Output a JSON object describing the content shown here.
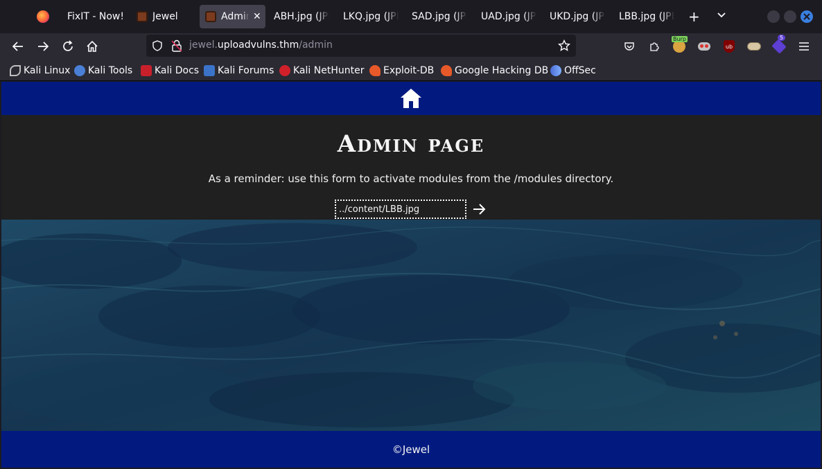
{
  "browser": {
    "tabs": [
      {
        "title": "FixIT - Now!",
        "favicon_color": "#1c1b22"
      },
      {
        "title": "Jewel",
        "favicon_color": "#7a3b1e"
      },
      {
        "title": "Admin",
        "favicon_color": "#7a3b1e",
        "active": true
      },
      {
        "title": "ABH.jpg (JPEG",
        "favicon_color": ""
      },
      {
        "title": "LKQ.jpg (JPEG",
        "favicon_color": ""
      },
      {
        "title": "SAD.jpg (JPEG",
        "favicon_color": ""
      },
      {
        "title": "UAD.jpg (JPEG",
        "favicon_color": ""
      },
      {
        "title": "UKD.jpg (JPEG",
        "favicon_color": ""
      },
      {
        "title": "LBB.jpg (JPEG",
        "favicon_color": ""
      }
    ],
    "url": {
      "prefix": "jewel.",
      "domain": "uploadvulns.thm",
      "path": "/admin"
    },
    "extension_badge": "5",
    "burp_label": "Burp"
  },
  "bookmarks": [
    {
      "label": "Kali Linux",
      "icon": "kali-dragon-icon",
      "color": "#bfbfbf"
    },
    {
      "label": "Kali Tools",
      "icon": "kali-tools-icon",
      "color": "#4a7fd6"
    },
    {
      "label": "Kali Docs",
      "icon": "kali-docs-icon",
      "color": "#c8202b"
    },
    {
      "label": "Kali Forums",
      "icon": "kali-forums-icon",
      "color": "#3b73c9"
    },
    {
      "label": "Kali NetHunter",
      "icon": "nethunter-icon",
      "color": "#d0212b"
    },
    {
      "label": "Exploit-DB",
      "icon": "exploit-db-icon",
      "color": "#e8592a"
    },
    {
      "label": "Google Hacking DB",
      "icon": "ghdb-icon",
      "color": "#e8592a"
    },
    {
      "label": "OffSec",
      "icon": "offsec-icon",
      "color": "#4b6cd6"
    }
  ],
  "page": {
    "title": "Admin page",
    "reminder": "As a reminder: use this form to activate modules from the /modules directory.",
    "module_input_value": "../content/LBB.jpg",
    "footer": "©Jewel",
    "colors": {
      "nav_blue": "#021a80",
      "panel": "#202020",
      "water": "#1b3f5c"
    }
  }
}
